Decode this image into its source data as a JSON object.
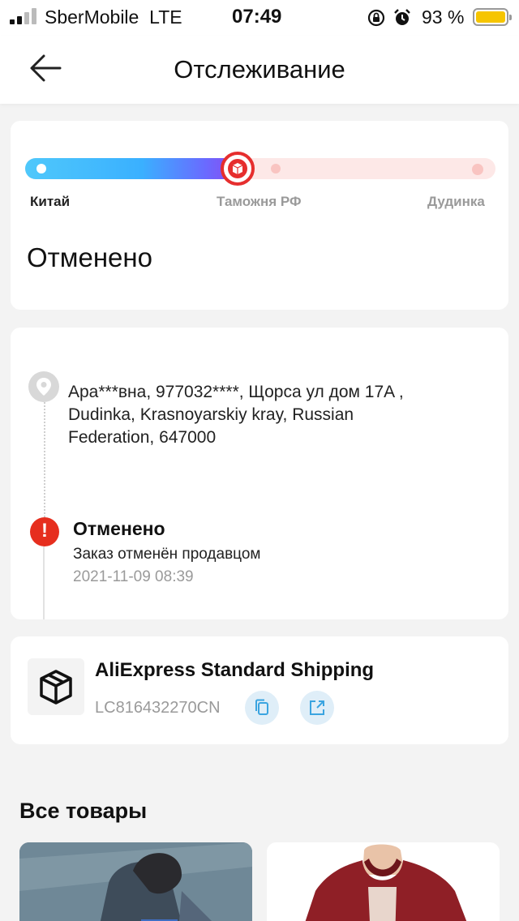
{
  "status_bar": {
    "carrier": "SberMobile",
    "network": "LTE",
    "time": "07:49",
    "battery": "93 %",
    "battery_color": "#f6c500"
  },
  "header": {
    "title": "Отслеживание",
    "back_icon": "arrow-left-icon"
  },
  "progress": {
    "stages": [
      "Китай",
      "Таможня РФ",
      "Дудинка"
    ],
    "current_stage_index": 1,
    "status": "Отменено",
    "accent_color": "#e62e2e"
  },
  "timeline": {
    "address": "Ара***вна,  977032****,  Щорса ул дом 17A ,  Dudinka,  Krasnoyarskiy kray,  Russian Federation,  647000",
    "event": {
      "title": "Отменено",
      "description": "Заказ отменён продавцом",
      "datetime": "2021-11-09 08:39"
    }
  },
  "shipping": {
    "carrier_name": "AliExpress Standard Shipping",
    "tracking_number": "LC816432270CN",
    "copy_icon": "copy-icon",
    "open_icon": "external-link-icon"
  },
  "products": {
    "title": "Все товары",
    "items": [
      "product-image-1",
      "product-image-2"
    ]
  }
}
